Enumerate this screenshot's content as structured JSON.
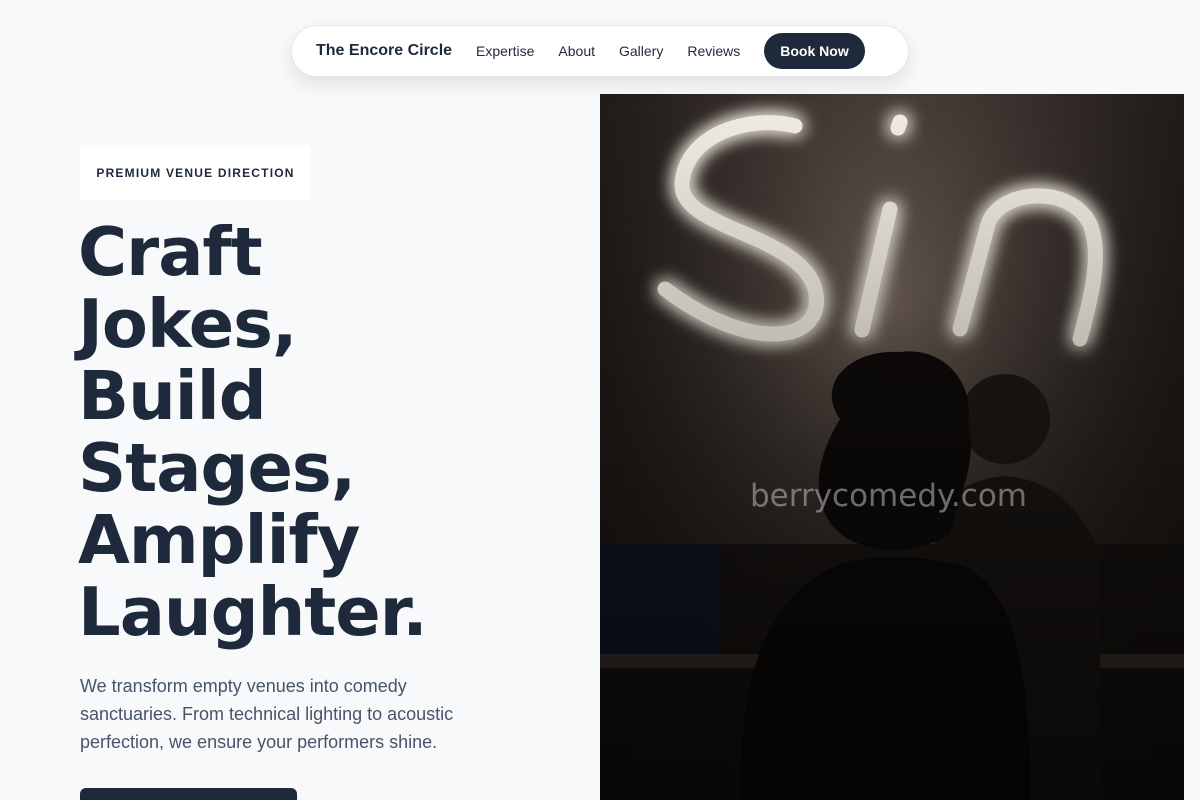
{
  "nav": {
    "brand": "The Encore Circle",
    "links": [
      "Expertise",
      "About",
      "Gallery",
      "Reviews"
    ],
    "cta": "Book Now"
  },
  "hero": {
    "eyebrow": "PREMIUM VENUE DIRECTION",
    "headline": [
      "Craft",
      "Jokes,",
      "Build",
      "Stages,",
      "Amplify",
      "Laughter."
    ],
    "lead": "We transform empty venues into comedy sanctuaries. From technical lighting to acoustic perfection, we ensure your performers shine.",
    "neon_sign": "Sin",
    "watermark": "berrycomedy.com"
  },
  "colors": {
    "accent": "#1e293b",
    "page_bg": "#f8f9fa",
    "body_text": "#475569"
  }
}
